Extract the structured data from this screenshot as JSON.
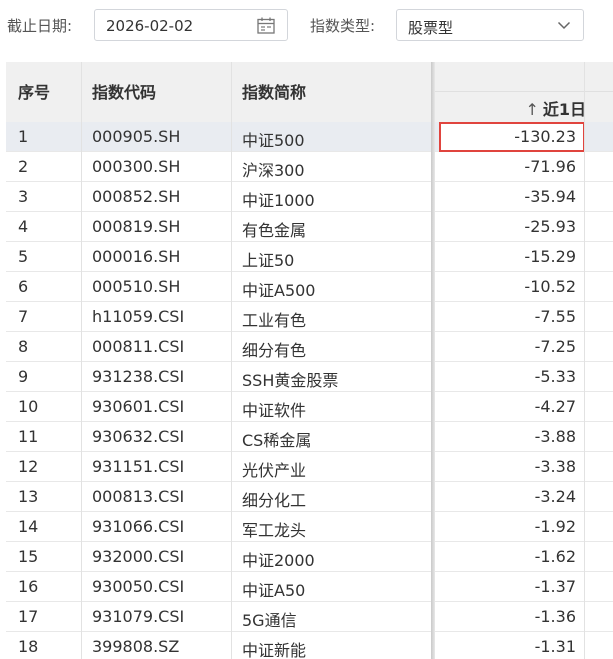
{
  "filters": {
    "date_label": "截止日期:",
    "date_value": "2026-02-02",
    "type_label": "指数类型:",
    "type_value": "股票型"
  },
  "table": {
    "columns": [
      "序号",
      "指数代码",
      "指数简称",
      "近1日"
    ],
    "sort_indicator": "↑",
    "rows": [
      {
        "idx": "1",
        "code": "000905.SH",
        "name": "中证500",
        "value": "-130.23"
      },
      {
        "idx": "2",
        "code": "000300.SH",
        "name": "沪深300",
        "value": "-71.96"
      },
      {
        "idx": "3",
        "code": "000852.SH",
        "name": "中证1000",
        "value": "-35.94"
      },
      {
        "idx": "4",
        "code": "000819.SH",
        "name": "有色金属",
        "value": "-25.93"
      },
      {
        "idx": "5",
        "code": "000016.SH",
        "name": "上证50",
        "value": "-15.29"
      },
      {
        "idx": "6",
        "code": "000510.SH",
        "name": "中证A500",
        "value": "-10.52"
      },
      {
        "idx": "7",
        "code": "h11059.CSI",
        "name": "工业有色",
        "value": "-7.55"
      },
      {
        "idx": "8",
        "code": "000811.CSI",
        "name": "细分有色",
        "value": "-7.25"
      },
      {
        "idx": "9",
        "code": "931238.CSI",
        "name": "SSH黄金股票",
        "value": "-5.33"
      },
      {
        "idx": "10",
        "code": "930601.CSI",
        "name": "中证软件",
        "value": "-4.27"
      },
      {
        "idx": "11",
        "code": "930632.CSI",
        "name": "CS稀金属",
        "value": "-3.88"
      },
      {
        "idx": "12",
        "code": "931151.CSI",
        "name": "光伏产业",
        "value": "-3.38"
      },
      {
        "idx": "13",
        "code": "000813.CSI",
        "name": "细分化工",
        "value": "-3.24"
      },
      {
        "idx": "14",
        "code": "931066.CSI",
        "name": "军工龙头",
        "value": "-1.92"
      },
      {
        "idx": "15",
        "code": "932000.CSI",
        "name": "中证2000",
        "value": "-1.62"
      },
      {
        "idx": "16",
        "code": "930050.CSI",
        "name": "中证A50",
        "value": "-1.37"
      },
      {
        "idx": "17",
        "code": "931079.CSI",
        "name": "5G通信",
        "value": "-1.36"
      },
      {
        "idx": "18",
        "code": "399808.SZ",
        "name": "中证新能",
        "value": "-1.31"
      }
    ]
  },
  "colors": {
    "highlight_border": "#e0443e",
    "header_bg": "#f0f0f0",
    "selected_row_bg": "#e9ecf1"
  }
}
